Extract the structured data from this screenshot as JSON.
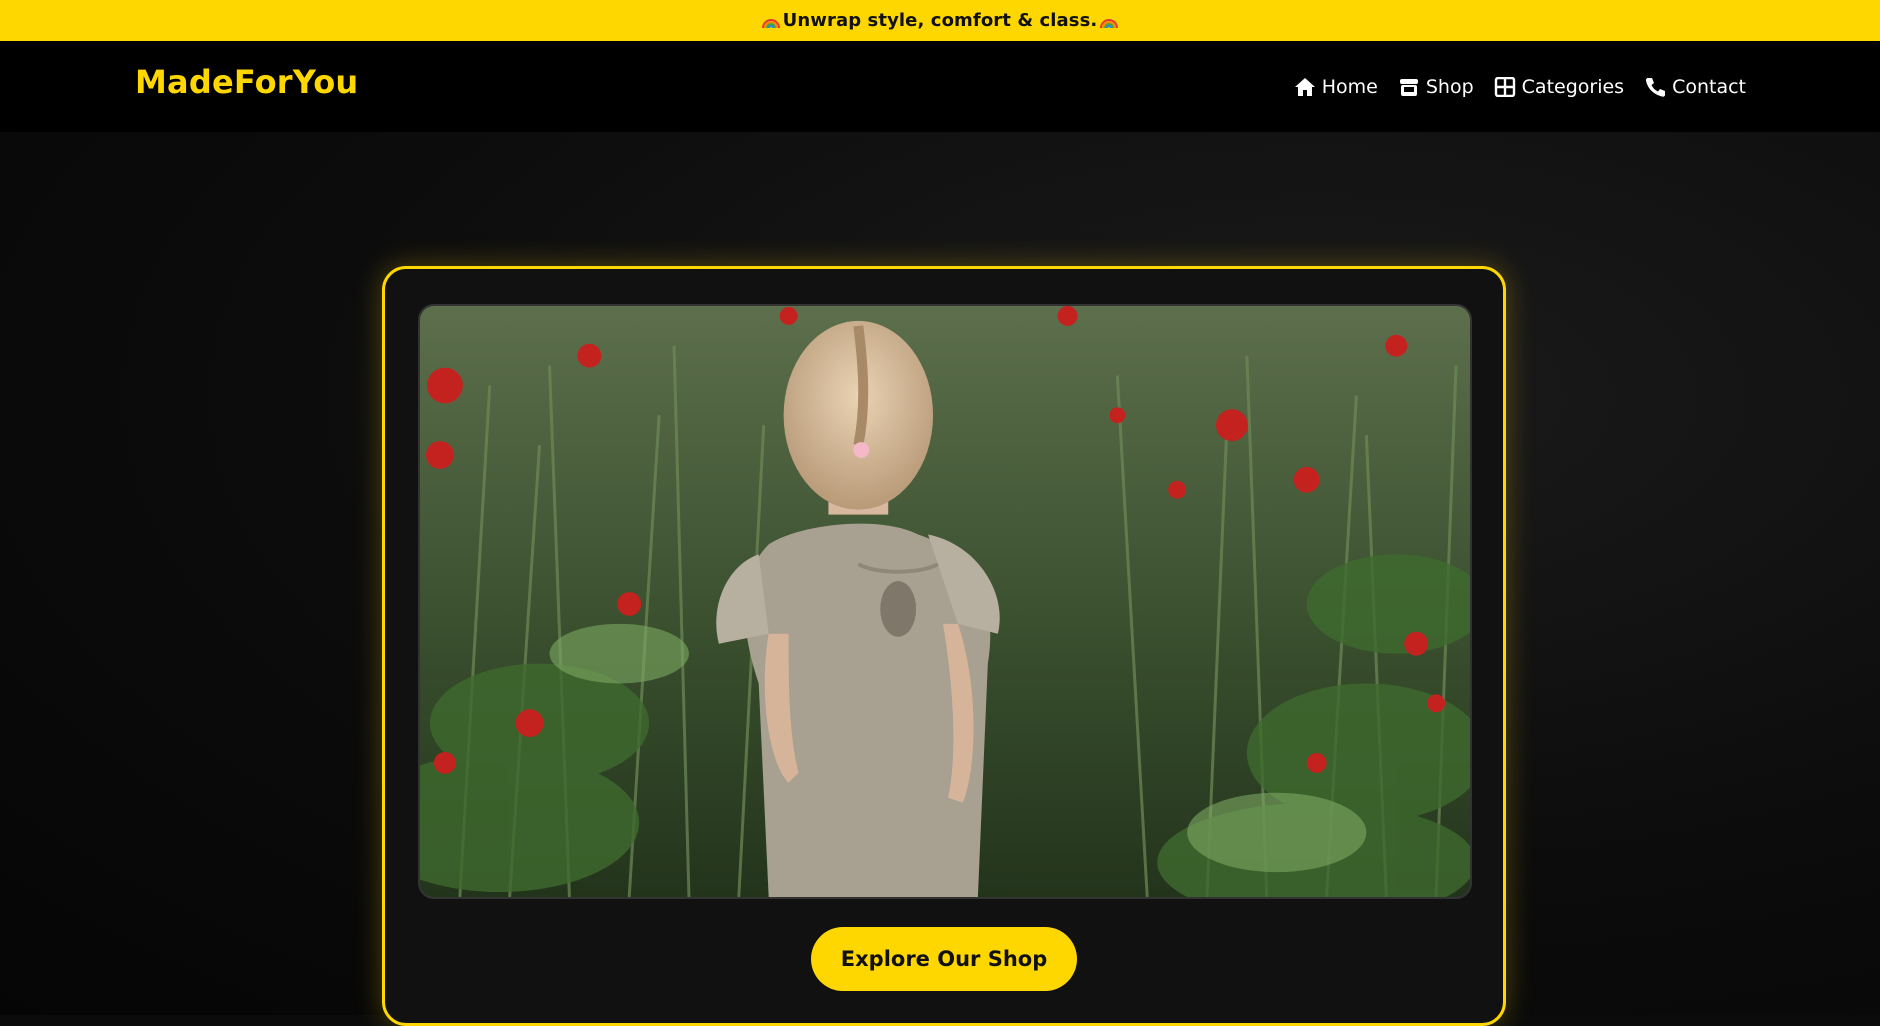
{
  "announcement": {
    "text": "Unwrap style, comfort & class.",
    "emoji": "rainbow"
  },
  "brand": {
    "name": "MadeForYou"
  },
  "nav": [
    {
      "label": "Home",
      "icon": "home-icon"
    },
    {
      "label": "Shop",
      "icon": "store-icon"
    },
    {
      "label": "Categories",
      "icon": "grid-icon"
    },
    {
      "label": "Contact",
      "icon": "phone-icon"
    }
  ],
  "hero": {
    "cta_label": "Explore Our Shop",
    "media": "video of a little girl in a linen dress walking through a field of grass and red poppies"
  },
  "colors": {
    "accent": "#ffd700",
    "navbar": "#000000",
    "background": "#0b0b0b"
  }
}
